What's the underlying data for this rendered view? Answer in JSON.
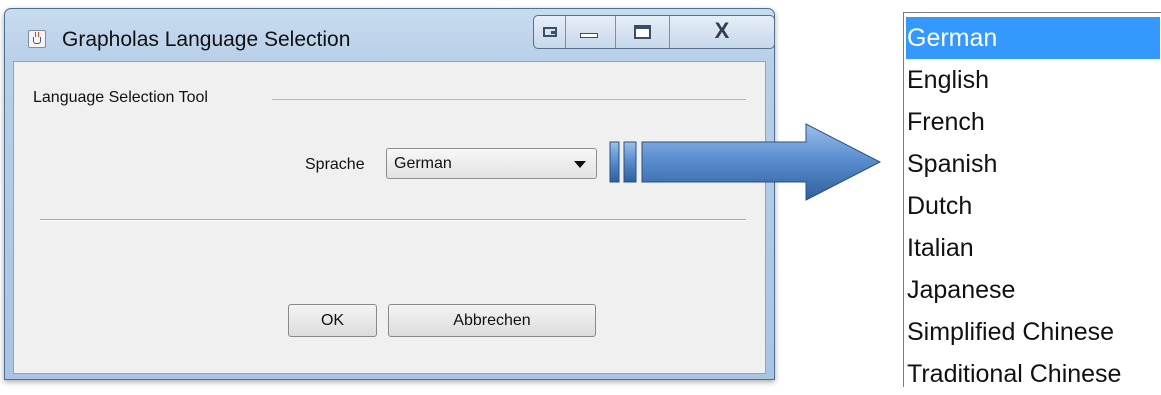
{
  "window": {
    "title": "Grapholas Language Selection",
    "caption_buttons": [
      "extra-icon",
      "minimize-icon",
      "maximize-icon",
      "close-icon"
    ],
    "close_glyph": "X"
  },
  "dialog": {
    "group_title": "Language Selection Tool",
    "language_label": "Sprache",
    "language_value": "German",
    "ok_label": "OK",
    "cancel_label": "Abbrechen"
  },
  "dropdown": {
    "options": [
      {
        "label": "German",
        "selected": true
      },
      {
        "label": "English",
        "selected": false
      },
      {
        "label": "French",
        "selected": false
      },
      {
        "label": "Spanish",
        "selected": false
      },
      {
        "label": "Dutch",
        "selected": false
      },
      {
        "label": "Italian",
        "selected": false
      },
      {
        "label": "Japanese",
        "selected": false
      },
      {
        "label": "Simplified Chinese",
        "selected": false
      },
      {
        "label": "Traditional Chinese",
        "selected": false
      }
    ]
  },
  "colors": {
    "selection": "#3399ff",
    "arrow": "#4a7fc0",
    "title_bar": "#b7cfe8"
  }
}
